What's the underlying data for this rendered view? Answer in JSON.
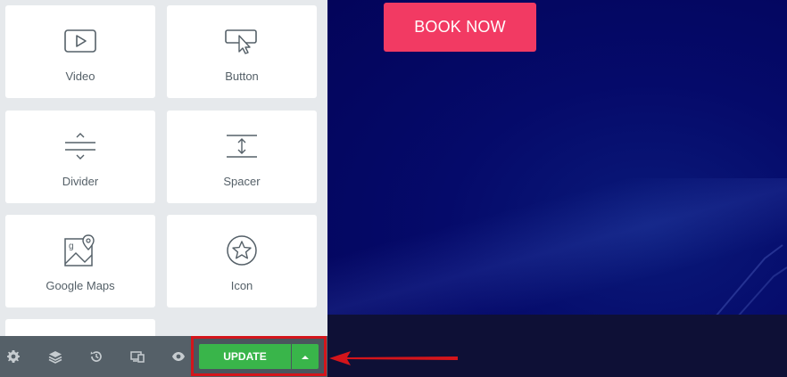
{
  "widgets": [
    {
      "label": "Video",
      "icon": "video-icon"
    },
    {
      "label": "Button",
      "icon": "button-icon"
    },
    {
      "label": "Divider",
      "icon": "divider-icon"
    },
    {
      "label": "Spacer",
      "icon": "spacer-icon"
    },
    {
      "label": "Google Maps",
      "icon": "google-maps-icon"
    },
    {
      "label": "Icon",
      "icon": "star-icon"
    }
  ],
  "canvas": {
    "book_button": "BOOK NOW"
  },
  "footer": {
    "icons": [
      "settings-icon",
      "layers-icon",
      "history-icon",
      "responsive-icon",
      "preview-icon"
    ],
    "update_label": "UPDATE"
  },
  "colors": {
    "accent": "#f23a63",
    "update_green": "#39b54a",
    "highlight_red": "#d4151b",
    "canvas_bg": "#03045a"
  }
}
